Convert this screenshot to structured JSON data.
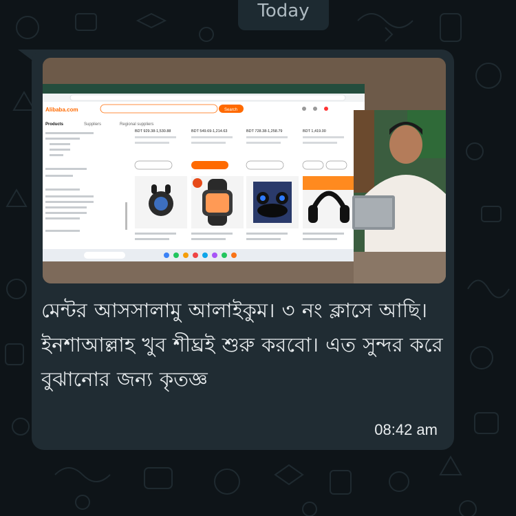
{
  "chat": {
    "date_separator": "Today"
  },
  "message": {
    "text": "মেন্টর আসসালামু আলাইকুম। ৩ নং ক্লাসে আছি। ইনশাআল্লাহ খুব শীঘ্রই শুরু করবো। এত সুন্দর করে বুঝানোর জন্য কৃতজ্ঞ",
    "time": "08:42 am"
  },
  "screenshot": {
    "browser_logo": "Alibaba.com",
    "search_button": "Search",
    "filter_tabs": [
      "Products",
      "Suppliers",
      "Regional suppliers"
    ],
    "prices": [
      "BDT 929.38-1,530.88",
      "BDT 549.69-1,214.63",
      "BDT 728.38-1,258.79",
      "BDT 1,419.00"
    ],
    "icon_names": [
      "earbuds-icon",
      "smartwatch-icon",
      "earbuds-case-icon",
      "headphones-icon"
    ]
  },
  "colors": {
    "bubble": "#202c33",
    "background": "#0e1418",
    "text": "#e9edef",
    "accent": "#ff6a00"
  }
}
